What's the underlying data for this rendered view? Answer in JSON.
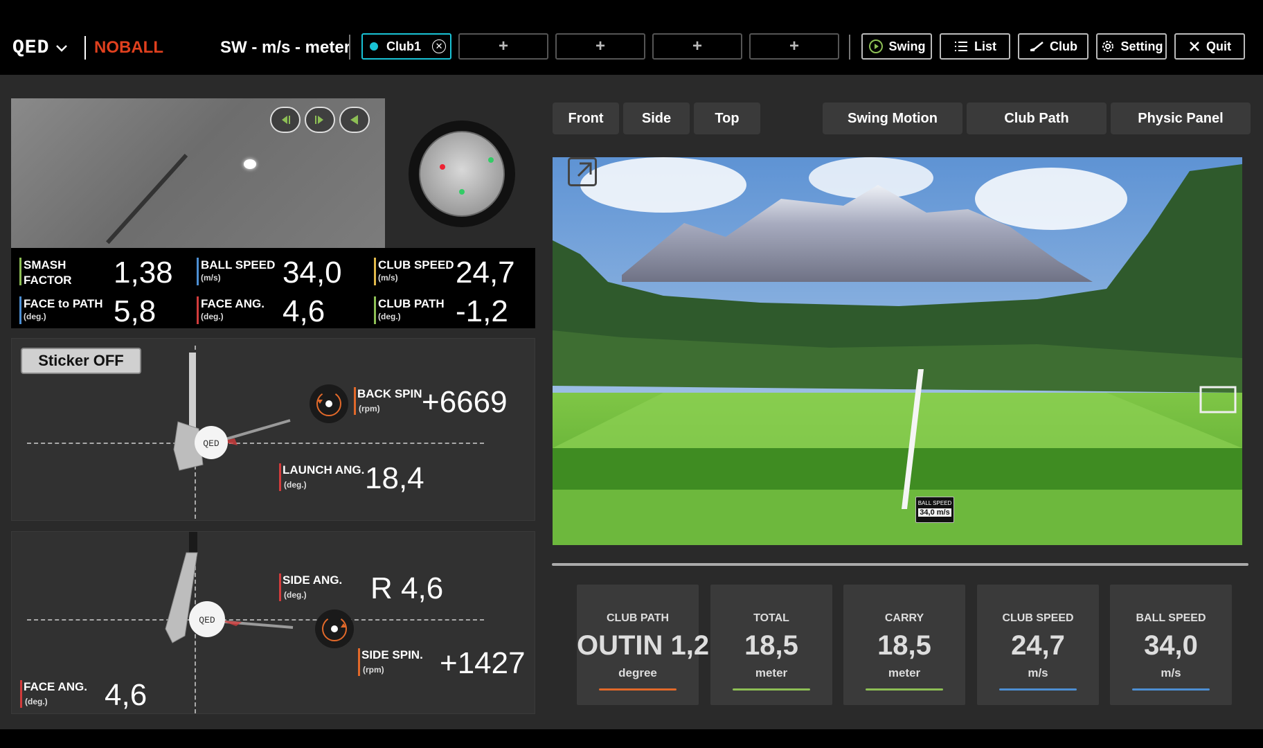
{
  "topbar": {
    "logo": "QED",
    "status": "NOBALL",
    "mode": "SW - m/s - meter",
    "club_tab": "Club1",
    "add_tabs": [
      "+",
      "+",
      "+",
      "+"
    ],
    "buttons": [
      "Swing",
      "List",
      "Club",
      "Setting",
      "Quit"
    ]
  },
  "colors": {
    "accent": "#19c3d6",
    "status": "#e0401e",
    "orange": "#e2692a",
    "green": "#8dbf55",
    "blue": "#4d8fd3",
    "red": "#d23c3c"
  },
  "stats": {
    "smash": {
      "label1": "SMASH",
      "label2": "FACTOR",
      "value": "1,38"
    },
    "ball_speed": {
      "label": "BALL SPEED",
      "unit": "(m/s)",
      "value": "34,0"
    },
    "club_speed": {
      "label": "CLUB SPEED",
      "unit": "(m/s)",
      "value": "24,7"
    },
    "face_to_path": {
      "label": "FACE to PATH",
      "unit": "(deg.)",
      "value": "5,8"
    },
    "face_ang": {
      "label": "FACE ANG.",
      "unit": "(deg.)",
      "value": "4,6"
    },
    "club_path": {
      "label": "CLUB PATH",
      "unit": "(deg.)",
      "value": "-1,2"
    }
  },
  "side_view": {
    "sticker": "Sticker OFF",
    "back_spin": {
      "label": "BACK SPIN",
      "unit": "(rpm)",
      "value": "+6669"
    },
    "launch_ang": {
      "label": "LAUNCH ANG.",
      "unit": "(deg.)",
      "value": "18,4"
    }
  },
  "top_view": {
    "side_ang": {
      "label": "SIDE ANG.",
      "unit": "(deg.)",
      "value": "R 4,6"
    },
    "side_spin": {
      "label": "SIDE SPIN.",
      "unit": "(rpm)",
      "value": "+1427"
    },
    "face_ang": {
      "label": "FACE ANG.",
      "unit": "(deg.)",
      "value": "4,6"
    }
  },
  "view_tabs": [
    "Front",
    "Side",
    "Top"
  ],
  "panel_tabs": [
    "Swing Motion",
    "Club Path",
    "Physic Panel"
  ],
  "scene_label": {
    "title": "BALL SPEED",
    "value": "34,0 m/s"
  },
  "cards": [
    {
      "title": "CLUB PATH",
      "value": "OUTIN 1,2",
      "unit": "degree",
      "color": "#e2692a"
    },
    {
      "title": "TOTAL",
      "value": "18,5",
      "unit": "meter",
      "color": "#8dbf55"
    },
    {
      "title": "CARRY",
      "value": "18,5",
      "unit": "meter",
      "color": "#8dbf55"
    },
    {
      "title": "CLUB SPEED",
      "value": "24,7",
      "unit": "m/s",
      "color": "#4d8fd3"
    },
    {
      "title": "BALL SPEED",
      "value": "34,0",
      "unit": "m/s",
      "color": "#4d8fd3"
    }
  ]
}
